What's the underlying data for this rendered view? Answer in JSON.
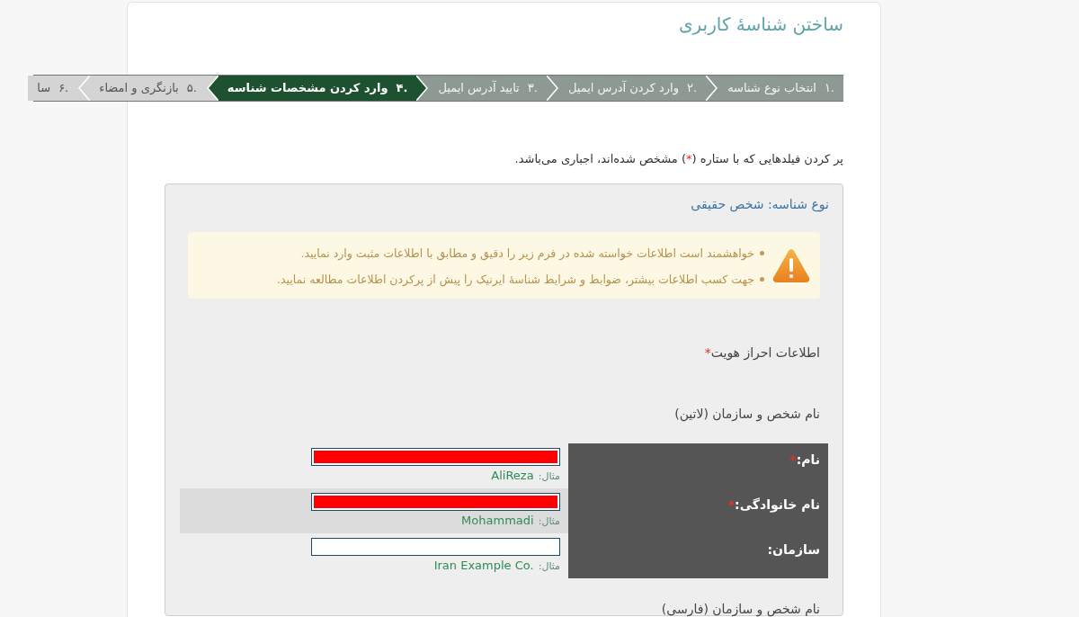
{
  "page_title": "ساختن شناسهٔ کاربری",
  "steps": [
    {
      "number": "۱.",
      "label": "انتخاب نوع شناسه",
      "completed": true,
      "selected": false
    },
    {
      "number": "۲.",
      "label": "وارد کردن آدرس ایمیل",
      "completed": true,
      "selected": false
    },
    {
      "number": "۳.",
      "label": "تایید آدرس ایمیل",
      "completed": true,
      "selected": false
    },
    {
      "number": "۴.",
      "label": "وارد کردن مشخصات شناسه",
      "completed": false,
      "selected": true
    },
    {
      "number": "۵.",
      "label": "بازنگری و امضاء",
      "completed": false,
      "selected": false
    },
    {
      "number": "۶.",
      "label": "سا",
      "completed": false,
      "selected": false
    }
  ],
  "required_note": {
    "before": "پر کردن فیلدهایی که با ستاره (",
    "mark": "*",
    "after": ") مشخص شده‌اند، اجباری می‌باشد."
  },
  "panel": {
    "title": "نوع شناسه: شخص حقیقی",
    "alert": {
      "items": [
        "خواهشمند است اطلاعات خواسته شده در فرم زیر را دقیق و مطابق با اطلاعات مثبت وارد نمایید.",
        "جهت کسب اطلاعات بیشتر، ضوابط و شرایط شناسهٔ ایرنیک را پیش از پرکردن اطلاعات مطالعه نمایید."
      ]
    },
    "section": {
      "title": "اطلاعات احراز هویت",
      "mark": "*"
    },
    "groups": [
      {
        "title": "نام شخص و سازمان (لاتین)",
        "fields": [
          {
            "label": "نام:",
            "mark": "*",
            "value_redacted": true,
            "highlighted": false,
            "example_prefix": "مثال:",
            "example": "AliReza"
          },
          {
            "label": "نام خانوادگی:",
            "mark": "*",
            "value_redacted": true,
            "highlighted": true,
            "example_prefix": "مثال:",
            "example": "Mohammadi"
          },
          {
            "label": "سازمان:",
            "value_redacted": false,
            "highlighted": false,
            "example_prefix": "مثال:",
            "example": "Iran Example Co."
          }
        ]
      },
      {
        "title": "نام شخص و سازمان (فارسی)"
      }
    ]
  }
}
